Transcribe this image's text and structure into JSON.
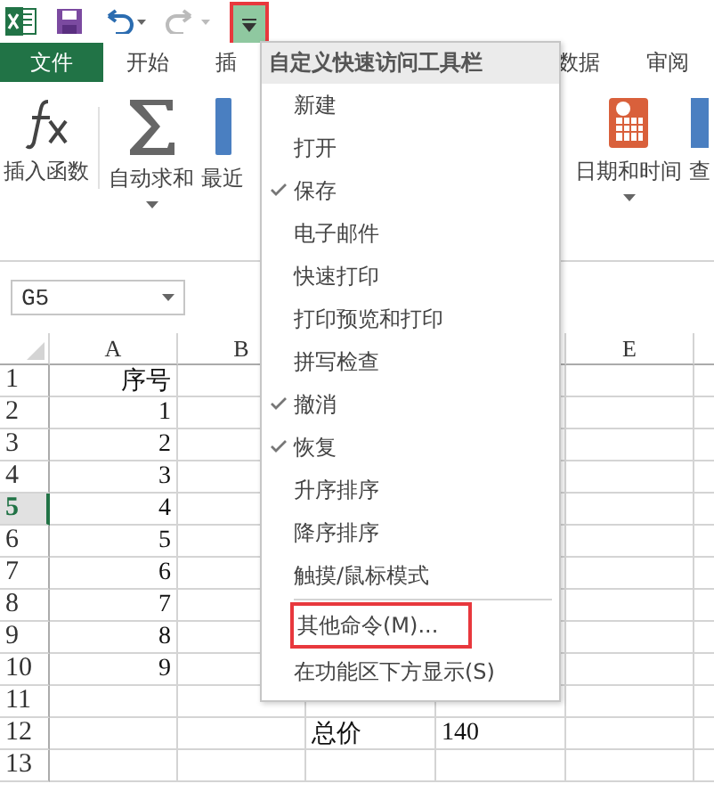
{
  "tabs": [
    {
      "label": "文件",
      "kind": "file",
      "selected": false
    },
    {
      "label": "开始",
      "kind": "tab",
      "selected": false
    },
    {
      "label": "插",
      "kind": "tab",
      "selected": false
    }
  ],
  "tabs_right": [
    {
      "label": "数据",
      "selected": false
    },
    {
      "label": "审阅",
      "selected": false
    }
  ],
  "ribbon_left": [
    {
      "label": "插入函数",
      "kind": "fx",
      "dropdown": false
    },
    {
      "label": "自动求和",
      "kind": "sum",
      "dropdown": true
    },
    {
      "label": "最近",
      "kind": "recent",
      "dropdown": false
    }
  ],
  "ribbon_right": [
    {
      "label": "日期和时间",
      "kind": "date",
      "dropdown": true
    },
    {
      "label": "查",
      "kind": "find",
      "dropdown": false
    }
  ],
  "name_box": "G5",
  "columns": [
    "A",
    "B",
    null,
    null,
    "E",
    null
  ],
  "rows": [
    {
      "number": "1",
      "selected": false,
      "cells": [
        "序号",
        null,
        null,
        null,
        null,
        null
      ]
    },
    {
      "number": "2",
      "selected": false,
      "cells": [
        "1",
        null,
        null,
        null,
        null,
        null
      ]
    },
    {
      "number": "3",
      "selected": false,
      "cells": [
        "2",
        null,
        null,
        null,
        null,
        null
      ]
    },
    {
      "number": "4",
      "selected": false,
      "cells": [
        "3",
        null,
        null,
        null,
        null,
        null
      ]
    },
    {
      "number": "5",
      "selected": true,
      "cells": [
        "4",
        null,
        null,
        null,
        null,
        null
      ]
    },
    {
      "number": "6",
      "selected": false,
      "cells": [
        "5",
        null,
        null,
        null,
        null,
        null
      ]
    },
    {
      "number": "7",
      "selected": false,
      "cells": [
        "6",
        null,
        null,
        null,
        null,
        null
      ]
    },
    {
      "number": "8",
      "selected": false,
      "cells": [
        "7",
        null,
        null,
        null,
        null,
        null
      ]
    },
    {
      "number": "9",
      "selected": false,
      "cells": [
        "8",
        null,
        null,
        null,
        null,
        null
      ]
    },
    {
      "number": "10",
      "selected": false,
      "cells": [
        "9",
        null,
        null,
        null,
        null,
        null
      ]
    },
    {
      "number": "11",
      "selected": false,
      "cells": [
        null,
        null,
        null,
        null,
        null,
        null
      ]
    },
    {
      "number": "12",
      "selected": false,
      "cells": [
        null,
        null,
        "总价",
        "140",
        null,
        null
      ]
    },
    {
      "number": "13",
      "selected": false,
      "cells": [
        null,
        null,
        null,
        null,
        null,
        null
      ]
    }
  ],
  "customize_button": {
    "annotated": true
  },
  "menu": {
    "title": "自定义快速访问工具栏",
    "items": [
      {
        "kind": "command",
        "label": "新建",
        "checked": false,
        "annotated": false
      },
      {
        "kind": "command",
        "label": "打开",
        "checked": false,
        "annotated": false
      },
      {
        "kind": "command",
        "label": "保存",
        "checked": true,
        "annotated": false
      },
      {
        "kind": "command",
        "label": "电子邮件",
        "checked": false,
        "annotated": false
      },
      {
        "kind": "command",
        "label": "快速打印",
        "checked": false,
        "annotated": false
      },
      {
        "kind": "command",
        "label": "打印预览和打印",
        "checked": false,
        "annotated": false
      },
      {
        "kind": "command",
        "label": "拼写检查",
        "checked": false,
        "annotated": false
      },
      {
        "kind": "command",
        "label": "撤消",
        "checked": true,
        "annotated": false
      },
      {
        "kind": "command",
        "label": "恢复",
        "checked": true,
        "annotated": false
      },
      {
        "kind": "command",
        "label": "升序排序",
        "checked": false,
        "annotated": false
      },
      {
        "kind": "command",
        "label": "降序排序",
        "checked": false,
        "annotated": false
      },
      {
        "kind": "command",
        "label": "触摸/鼠标模式",
        "checked": false,
        "annotated": false
      },
      {
        "kind": "separator"
      },
      {
        "kind": "action",
        "label": "其他命令(M)...",
        "annotated": true
      },
      {
        "kind": "action",
        "label": "在功能区下方显示(S)",
        "annotated": false
      }
    ]
  }
}
